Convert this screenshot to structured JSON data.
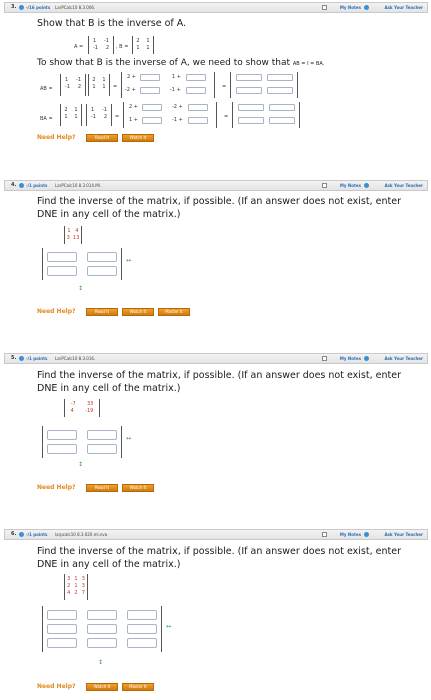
{
  "q3": {
    "number": "3.",
    "points": "-/16 points",
    "source": "LarPCalc10 8.3.006.",
    "my_notes": "My Notes",
    "ask": "Ask Your Teacher",
    "prompt": "Show that B is the inverse of A.",
    "matrix_A": [
      [
        "1",
        "-1"
      ],
      [
        "-1",
        "2"
      ]
    ],
    "matrix_B": [
      [
        "2",
        "1"
      ],
      [
        "1",
        "1"
      ]
    ],
    "A_label": "A =",
    "B_label": ", B =",
    "instruction": "To show that B is the inverse of A, we need to show that",
    "condition": "AB = I = BA.",
    "ab_label": "AB =",
    "ba_label": "BA =",
    "ab_prefix": [
      "2 +",
      "1 +",
      "-2 +",
      "-1 +"
    ],
    "ba_prefix": [
      "2 +",
      "-2 +",
      "1 +",
      "-1 +"
    ],
    "need_help": "Need Help?",
    "buttons": [
      "Read It",
      "Watch It"
    ]
  },
  "q4": {
    "number": "4.",
    "points": "-/1 points",
    "source": "LarPCalc10 8.3.014.MI.",
    "my_notes": "My Notes",
    "ask": "Ask Your Teacher",
    "prompt": "Find the inverse of the matrix, if possible. (If an answer does not exist, enter DNE in any cell of the matrix.)",
    "matrix": [
      [
        "1",
        "4"
      ],
      [
        "3",
        "13"
      ]
    ],
    "need_help": "Need Help?",
    "buttons": [
      "Read It",
      "Watch It",
      "Master It"
    ]
  },
  "q5": {
    "number": "5.",
    "points": "-/1 points",
    "source": "LarPCalc10 8.3.016.",
    "my_notes": "My Notes",
    "ask": "Ask Your Teacher",
    "prompt": "Find the inverse of the matrix, if possible. (If an answer does not exist, enter DNE in any cell of the matrix.)",
    "matrix": [
      [
        "-7",
        "33"
      ],
      [
        "4",
        "-19"
      ]
    ],
    "need_help": "Need Help?",
    "buttons": [
      "Read It",
      "Watch It"
    ]
  },
  "q6": {
    "number": "6.",
    "points": "-/1 points",
    "source": "larpcalc10 8.3.020.mi.nva",
    "my_notes": "My Notes",
    "ask": "Ask Your Teacher",
    "prompt": "Find the inverse of the matrix, if possible. (If an answer does not exist, enter DNE in any cell of the matrix.)",
    "matrix": [
      [
        "3",
        "1",
        "3"
      ],
      [
        "2",
        "1",
        "3"
      ],
      [
        "4",
        "2",
        "7"
      ]
    ],
    "need_help": "Need Help?",
    "buttons": [
      "Watch It",
      "Master It"
    ]
  },
  "icons": {
    "row_col_arrows": "↔ / ↕ add-remove arrows",
    "accent_color": "#e08a1e",
    "link_color": "#2a6fb8"
  }
}
